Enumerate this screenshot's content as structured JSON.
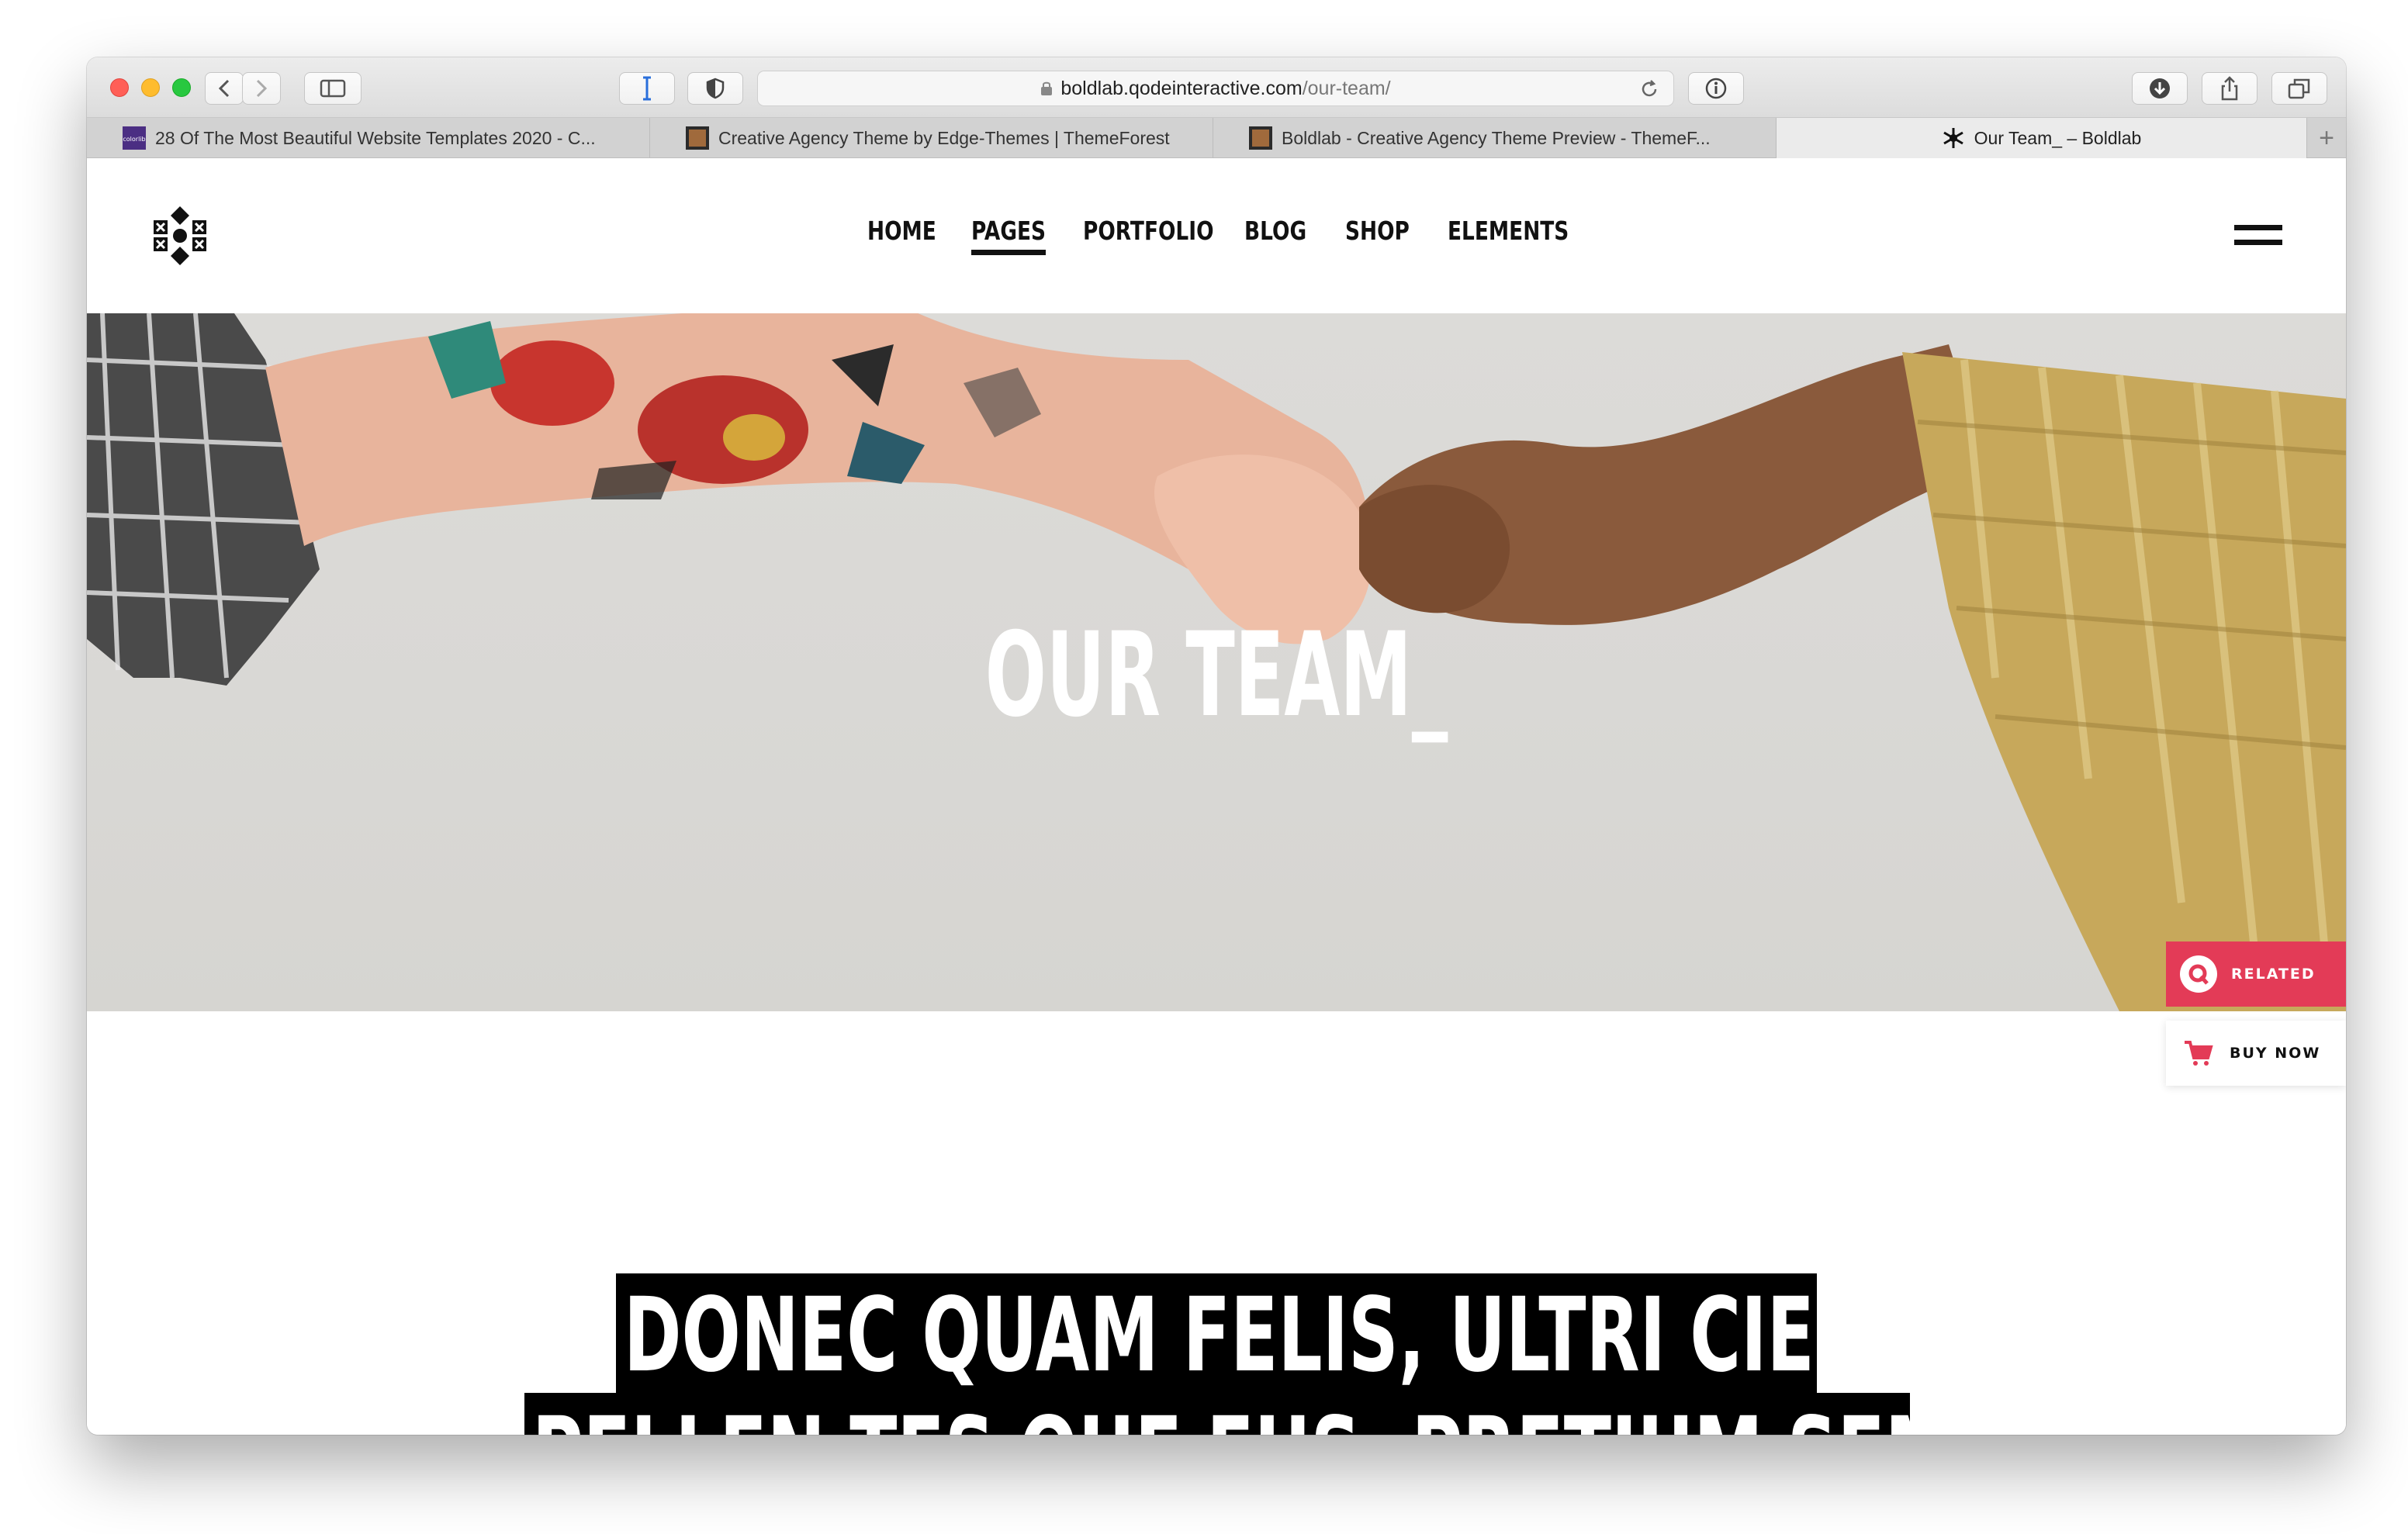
{
  "browser": {
    "address": {
      "domain": "boldlab.qodeinteractive.com",
      "path": "/our-team/"
    },
    "tabs": [
      {
        "label": "28 Of The Most Beautiful Website Templates 2020 - C...",
        "favicon": "colorlib-favicon"
      },
      {
        "label": "Creative Agency Theme by Edge-Themes | ThemeForest",
        "favicon": "themeforest-favicon"
      },
      {
        "label": "Boldlab - Creative Agency Theme Preview - ThemeF...",
        "favicon": "themeforest-favicon"
      },
      {
        "label": "Our Team_ – Boldlab",
        "favicon": "boldlab-favicon",
        "active": true
      }
    ],
    "new_tab": "+"
  },
  "site": {
    "nav": [
      "HOME",
      "PAGES",
      "PORTFOLIO",
      "BLOG",
      "SHOP",
      "ELEMENTS"
    ],
    "active_nav": "PAGES",
    "hero": {
      "title": "OUR TEAM_"
    },
    "floating": {
      "related": "RELATED",
      "buy_now": "BUY NOW"
    },
    "headline": [
      "DONEC QUAM FELIS, ULTRI CIES,",
      "PELLEN TES QUE EUS, PRETIUM SEM."
    ]
  },
  "colors": {
    "accent": "#e33b57",
    "text": "#111111"
  }
}
